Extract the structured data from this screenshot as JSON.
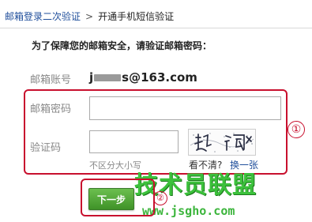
{
  "breadcrumb": {
    "parent": "邮箱登录二次验证",
    "separator": ">",
    "current": "开通手机短信验证"
  },
  "instruction": "为了保障您的邮箱安全，请验证邮箱密码：",
  "form": {
    "account_label": "邮箱账号",
    "account_prefix": "j",
    "account_suffix": "s@163.com",
    "password_label": "邮箱密码",
    "password_value": "",
    "code_label": "验证码",
    "code_value": "",
    "code_hint": "不区分大小写",
    "captcha_unclear": "看不清?",
    "captcha_change": "换一张",
    "next_label": "下一步"
  },
  "annotations": {
    "marker_1": "①",
    "marker_2": "②"
  },
  "watermark": {
    "brand": "技术员联盟",
    "url": "www.jsgho.com"
  },
  "colors": {
    "link": "#1f4e9b",
    "annotation_red": "#c8102e",
    "button_green": "#4fa235",
    "watermark_green": "#3cc13c"
  }
}
